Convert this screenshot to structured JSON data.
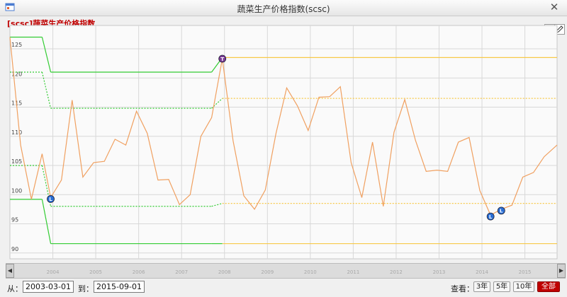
{
  "window": {
    "title": "蔬菜生产价格指数(scsc)",
    "close_glyph": "✕"
  },
  "chart_title": "[scsc]蔬菜生产价格指数",
  "toolbar": {
    "erase_icon": "eraser-icon",
    "pencil_icon": "pencil-icon"
  },
  "scrollbar": {
    "left_glyph": "◀",
    "right_glyph": "▶",
    "ticks": [
      "2004",
      "2005",
      "2006",
      "2007",
      "2008",
      "2009",
      "2010",
      "2011",
      "2012",
      "2013",
      "2014",
      "2015"
    ]
  },
  "range": {
    "from_label": "从：",
    "from_value": "2003-03-01",
    "to_label": "到：",
    "to_value": "2015-09-01",
    "view_label": "查看：",
    "buttons": [
      {
        "label": "3年",
        "active": false
      },
      {
        "label": "5年",
        "active": false
      },
      {
        "label": "10年",
        "active": false
      },
      {
        "label": "全部",
        "active": true
      }
    ]
  },
  "colors": {
    "price": "#f0a060",
    "green_band": "#33cc33",
    "yellow_band": "#f7c948",
    "marker_blue": "#2a6fd6",
    "marker_purple": "#7a3a96",
    "grid": "#d8d8d8",
    "accent": "#c00000"
  },
  "chart_data": {
    "type": "line",
    "ylim": [
      89,
      129
    ],
    "yticks": [
      90,
      95,
      100,
      105,
      110,
      115,
      120,
      125
    ],
    "x_range": [
      2003.0,
      2015.75
    ],
    "x_ticks": [
      "2004",
      "2005",
      "2006",
      "2007",
      "2008",
      "2009",
      "2010",
      "2011",
      "2012",
      "2013",
      "2014",
      "2015"
    ],
    "grid": true,
    "series": [
      {
        "values": [
          [
            2003.0,
            127.0
          ],
          [
            2003.25,
            108.5
          ],
          [
            2003.5,
            99.2
          ],
          [
            2003.75,
            107.0
          ],
          [
            2003.95,
            99.5
          ],
          [
            2004.2,
            102.5
          ],
          [
            2004.45,
            116.2
          ],
          [
            2004.7,
            103.0
          ],
          [
            2004.95,
            105.5
          ],
          [
            2005.2,
            105.7
          ],
          [
            2005.45,
            109.5
          ],
          [
            2005.7,
            108.5
          ],
          [
            2005.95,
            114.3
          ],
          [
            2006.2,
            110.5
          ],
          [
            2006.45,
            102.5
          ],
          [
            2006.7,
            102.6
          ],
          [
            2006.95,
            98.3
          ],
          [
            2007.2,
            100.0
          ],
          [
            2007.45,
            110.0
          ],
          [
            2007.7,
            113.2
          ],
          [
            2007.95,
            123.3
          ],
          [
            2008.2,
            109.2
          ],
          [
            2008.45,
            99.8
          ],
          [
            2008.7,
            97.5
          ],
          [
            2008.95,
            100.8
          ],
          [
            2009.2,
            110.5
          ],
          [
            2009.45,
            118.3
          ],
          [
            2009.7,
            115.2
          ],
          [
            2009.95,
            111.0
          ],
          [
            2010.2,
            116.7
          ],
          [
            2010.45,
            116.8
          ],
          [
            2010.7,
            118.5
          ],
          [
            2010.95,
            105.5
          ],
          [
            2011.2,
            99.5
          ],
          [
            2011.45,
            109.0
          ],
          [
            2011.7,
            98.0
          ],
          [
            2011.95,
            110.7
          ],
          [
            2012.2,
            116.3
          ],
          [
            2012.45,
            109.3
          ],
          [
            2012.7,
            104.0
          ],
          [
            2012.95,
            104.2
          ],
          [
            2013.2,
            104.0
          ],
          [
            2013.45,
            109.0
          ],
          [
            2013.7,
            109.8
          ],
          [
            2013.95,
            100.7
          ],
          [
            2014.2,
            96.5
          ],
          [
            2014.45,
            97.5
          ],
          [
            2014.7,
            98.2
          ],
          [
            2014.95,
            103.0
          ],
          [
            2015.2,
            103.8
          ],
          [
            2015.45,
            106.5
          ],
          [
            2015.75,
            108.5
          ]
        ]
      }
    ],
    "bands": [
      {
        "segments": [
          [
            2003.0,
            2003.75,
            127.0
          ],
          [
            2003.95,
            2007.7,
            121.0
          ],
          [
            2007.95,
            2015.75,
            123.5
          ]
        ]
      },
      {
        "segments": [
          [
            2003.0,
            2003.75,
            121.0
          ],
          [
            2003.95,
            2007.7,
            114.8
          ],
          [
            2007.95,
            2015.75,
            116.5
          ]
        ]
      },
      {
        "segments": [
          [
            2003.0,
            2003.75,
            105.0
          ],
          [
            2003.95,
            2007.7,
            98.0
          ],
          [
            2007.95,
            2015.75,
            98.5
          ]
        ]
      },
      {
        "segments": [
          [
            2003.0,
            2003.75,
            99.2
          ],
          [
            2003.95,
            2007.7,
            91.6
          ],
          [
            2007.95,
            2015.75,
            91.6
          ]
        ]
      }
    ],
    "markers": [
      {
        "x": 2003.95,
        "y": 99.5,
        "label": "L"
      },
      {
        "x": 2007.95,
        "y": 123.3,
        "label": "T"
      },
      {
        "x": 2014.2,
        "y": 96.5,
        "label": "L"
      },
      {
        "x": 2014.45,
        "y": 97.5,
        "label": "L"
      }
    ]
  }
}
